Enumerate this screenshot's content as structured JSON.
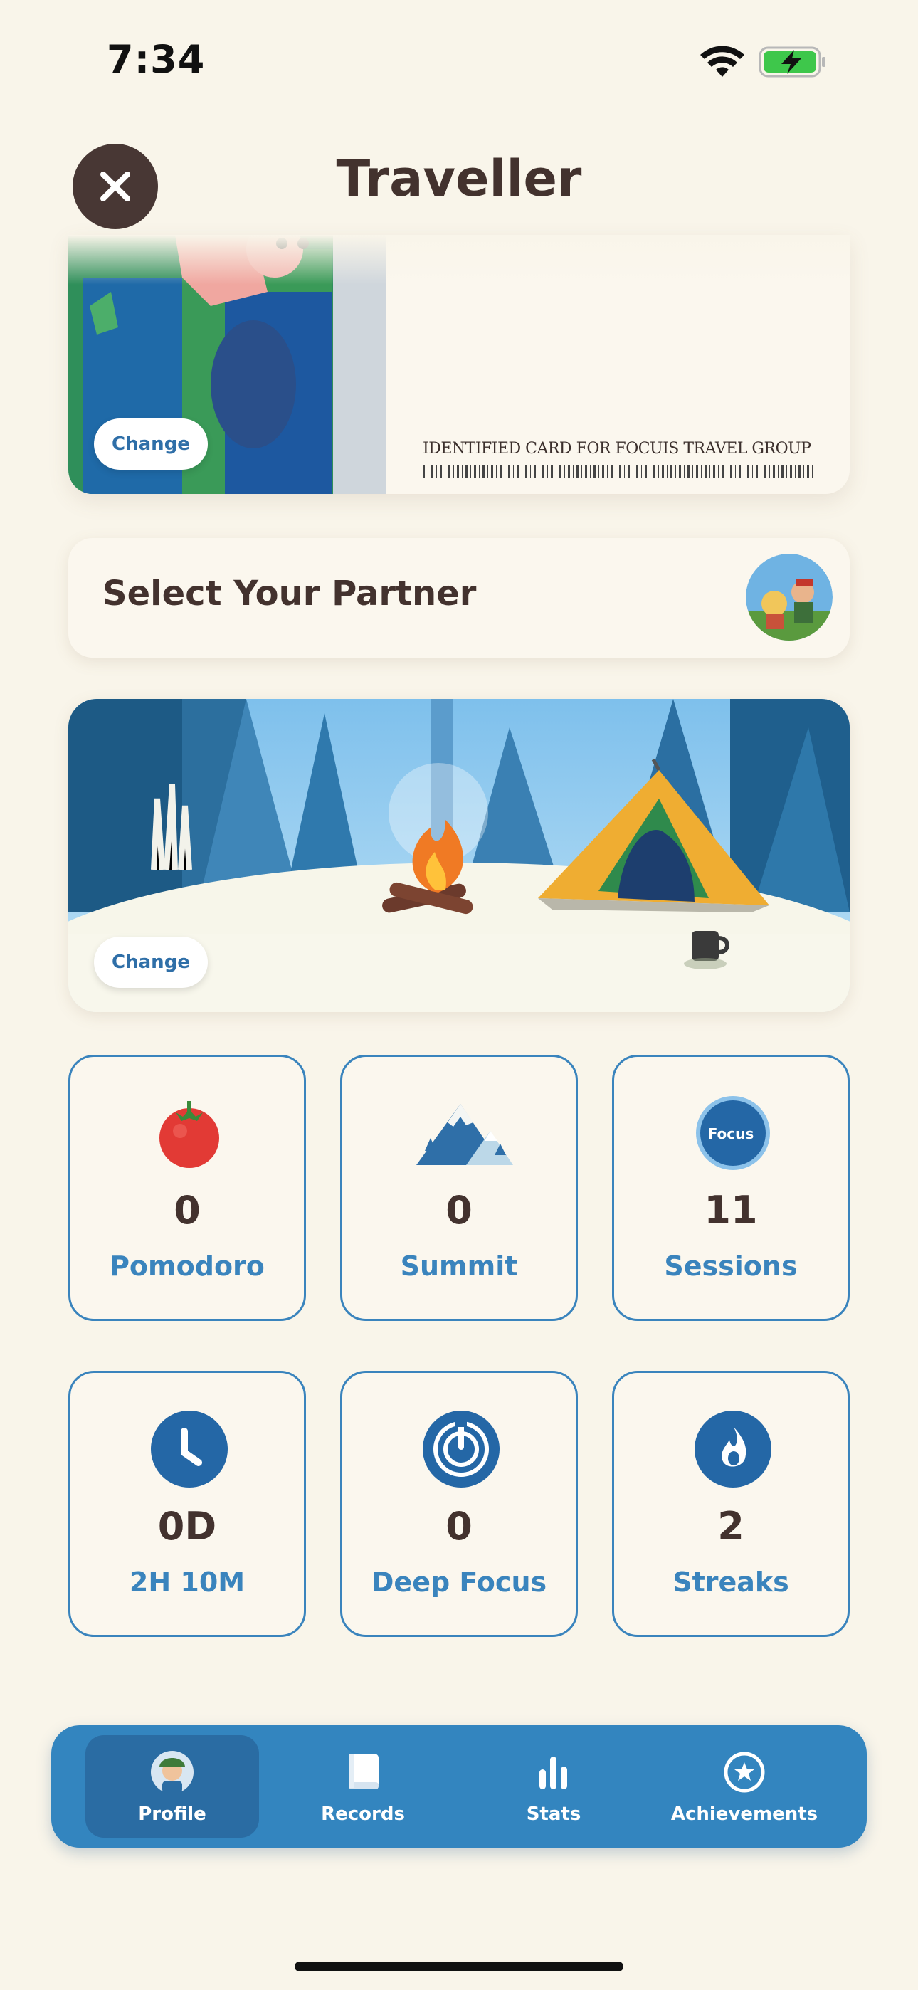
{
  "status_bar": {
    "time": "7:34"
  },
  "header": {
    "title": "Traveller"
  },
  "id_card": {
    "caption": "IDENTIFIED CARD FOR FOCUIS TRAVEL GROUP",
    "change_label": "Change"
  },
  "partner": {
    "label": "Select Your Partner"
  },
  "scene": {
    "change_label": "Change"
  },
  "stats": [
    {
      "value": "0",
      "label": "Pomodoro",
      "icon": "tomato-icon"
    },
    {
      "value": "0",
      "label": "Summit",
      "icon": "mountain-icon"
    },
    {
      "value": "11",
      "label": "Sessions",
      "icon": "focus-badge-icon",
      "badge_text": "Focus"
    },
    {
      "value": "0D",
      "label": "2H 10M",
      "icon": "clock-icon"
    },
    {
      "value": "0",
      "label": "Deep Focus",
      "icon": "deep-focus-icon"
    },
    {
      "value": "2",
      "label": "Streaks",
      "icon": "flame-icon"
    }
  ],
  "tabs": [
    {
      "label": "Profile",
      "icon": "profile-avatar-icon",
      "active": true
    },
    {
      "label": "Records",
      "icon": "book-icon",
      "active": false
    },
    {
      "label": "Stats",
      "icon": "bar-chart-icon",
      "active": false
    },
    {
      "label": "Achievements",
      "icon": "star-badge-icon",
      "active": false
    }
  ],
  "colors": {
    "background": "#f9f5ea",
    "accent": "#3a84bd",
    "text": "#43322e",
    "tabbar": "#3385bf"
  }
}
